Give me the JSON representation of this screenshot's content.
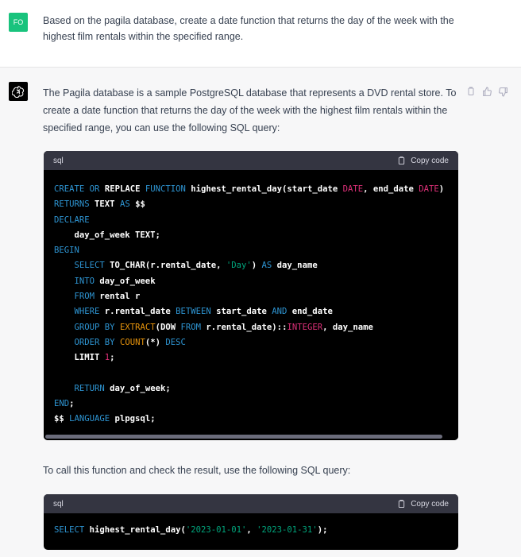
{
  "user": {
    "avatar_initials": "FO",
    "message": "Based on the pagila database, create a date function that returns the day of the week with the highest film rentals within the specified range."
  },
  "assistant": {
    "intro": "The Pagila database is a sample PostgreSQL database that represents a DVD rental store. To create a date function that returns the day of the week with the highest film rentals within the specified range, you can use the following SQL query:",
    "actions": [
      "copy-icon",
      "thumbs-up-icon",
      "thumbs-down-icon"
    ],
    "code_block_1": {
      "language": "sql",
      "copy_label": "Copy code",
      "lines": [
        [
          {
            "t": "kw",
            "v": "CREATE"
          },
          {
            "t": "p",
            "v": " "
          },
          {
            "t": "kw",
            "v": "OR"
          },
          {
            "t": "p",
            "v": " REPLACE "
          },
          {
            "t": "kw",
            "v": "FUNCTION"
          },
          {
            "t": "p",
            "v": " highest_rental_day(start_date "
          },
          {
            "t": "type",
            "v": "DATE"
          },
          {
            "t": "p",
            "v": ", end_date "
          },
          {
            "t": "type",
            "v": "DATE"
          },
          {
            "t": "p",
            "v": ")"
          }
        ],
        [
          {
            "t": "kw",
            "v": "RETURNS"
          },
          {
            "t": "p",
            "v": " TEXT "
          },
          {
            "t": "kw",
            "v": "AS"
          },
          {
            "t": "p",
            "v": " $$"
          }
        ],
        [
          {
            "t": "kw",
            "v": "DECLARE"
          }
        ],
        [
          {
            "t": "p",
            "v": "    day_of_week TEXT;"
          }
        ],
        [
          {
            "t": "kw",
            "v": "BEGIN"
          }
        ],
        [
          {
            "t": "p",
            "v": "    "
          },
          {
            "t": "kw",
            "v": "SELECT"
          },
          {
            "t": "p",
            "v": " TO_CHAR(r.rental_date, "
          },
          {
            "t": "str",
            "v": "'Day'"
          },
          {
            "t": "p",
            "v": ") "
          },
          {
            "t": "kw",
            "v": "AS"
          },
          {
            "t": "p",
            "v": " day_name"
          }
        ],
        [
          {
            "t": "p",
            "v": "    "
          },
          {
            "t": "kw",
            "v": "INTO"
          },
          {
            "t": "p",
            "v": " day_of_week"
          }
        ],
        [
          {
            "t": "p",
            "v": "    "
          },
          {
            "t": "kw",
            "v": "FROM"
          },
          {
            "t": "p",
            "v": " rental r"
          }
        ],
        [
          {
            "t": "p",
            "v": "    "
          },
          {
            "t": "kw",
            "v": "WHERE"
          },
          {
            "t": "p",
            "v": " r.rental_date "
          },
          {
            "t": "kw",
            "v": "BETWEEN"
          },
          {
            "t": "p",
            "v": " start_date "
          },
          {
            "t": "kw",
            "v": "AND"
          },
          {
            "t": "p",
            "v": " end_date"
          }
        ],
        [
          {
            "t": "p",
            "v": "    "
          },
          {
            "t": "kw",
            "v": "GROUP"
          },
          {
            "t": "p",
            "v": " "
          },
          {
            "t": "kw",
            "v": "BY"
          },
          {
            "t": "p",
            "v": " "
          },
          {
            "t": "ex",
            "v": "EXTRACT"
          },
          {
            "t": "p",
            "v": "(DOW "
          },
          {
            "t": "kw",
            "v": "FROM"
          },
          {
            "t": "p",
            "v": " r.rental_date)::"
          },
          {
            "t": "type",
            "v": "INTEGER"
          },
          {
            "t": "p",
            "v": ", day_name"
          }
        ],
        [
          {
            "t": "p",
            "v": "    "
          },
          {
            "t": "kw",
            "v": "ORDER"
          },
          {
            "t": "p",
            "v": " "
          },
          {
            "t": "kw",
            "v": "BY"
          },
          {
            "t": "p",
            "v": " "
          },
          {
            "t": "ex",
            "v": "COUNT"
          },
          {
            "t": "p",
            "v": "(*) "
          },
          {
            "t": "kw",
            "v": "DESC"
          }
        ],
        [
          {
            "t": "p",
            "v": "    LIMIT "
          },
          {
            "t": "num",
            "v": "1"
          },
          {
            "t": "p",
            "v": ";"
          }
        ],
        [
          {
            "t": "p",
            "v": ""
          }
        ],
        [
          {
            "t": "p",
            "v": "    "
          },
          {
            "t": "kw",
            "v": "RETURN"
          },
          {
            "t": "p",
            "v": " day_of_week;"
          }
        ],
        [
          {
            "t": "kw",
            "v": "END"
          },
          {
            "t": "p",
            "v": ";"
          }
        ],
        [
          {
            "t": "p",
            "v": "$$ "
          },
          {
            "t": "kw",
            "v": "LANGUAGE"
          },
          {
            "t": "p",
            "v": " plpgsql;"
          }
        ]
      ]
    },
    "middle": "To call this function and check the result, use the following SQL query:",
    "code_block_2": {
      "language": "sql",
      "copy_label": "Copy code",
      "lines": [
        [
          {
            "t": "kw",
            "v": "SELECT"
          },
          {
            "t": "p",
            "v": " highest_rental_day("
          },
          {
            "t": "str",
            "v": "'2023-01-01'"
          },
          {
            "t": "p",
            "v": ", "
          },
          {
            "t": "str",
            "v": "'2023-01-31'"
          },
          {
            "t": "p",
            "v": ");"
          }
        ]
      ]
    }
  }
}
